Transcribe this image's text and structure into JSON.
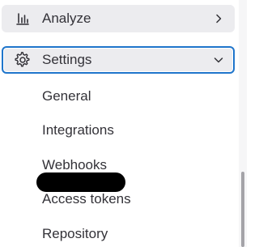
{
  "nav": {
    "analyze": {
      "label": "Analyze",
      "icon": "chart-bar-icon"
    },
    "settings": {
      "label": "Settings",
      "icon": "gear-icon",
      "expanded": true,
      "sub_items": [
        {
          "label": "General"
        },
        {
          "label": "Integrations"
        },
        {
          "label": "Webhooks"
        },
        {
          "label": "Access tokens"
        },
        {
          "label": "Repository"
        }
      ]
    }
  },
  "colors": {
    "row_background": "#ececef",
    "focus_border": "#1f75cb",
    "text": "#333238",
    "redaction": "#000000"
  }
}
